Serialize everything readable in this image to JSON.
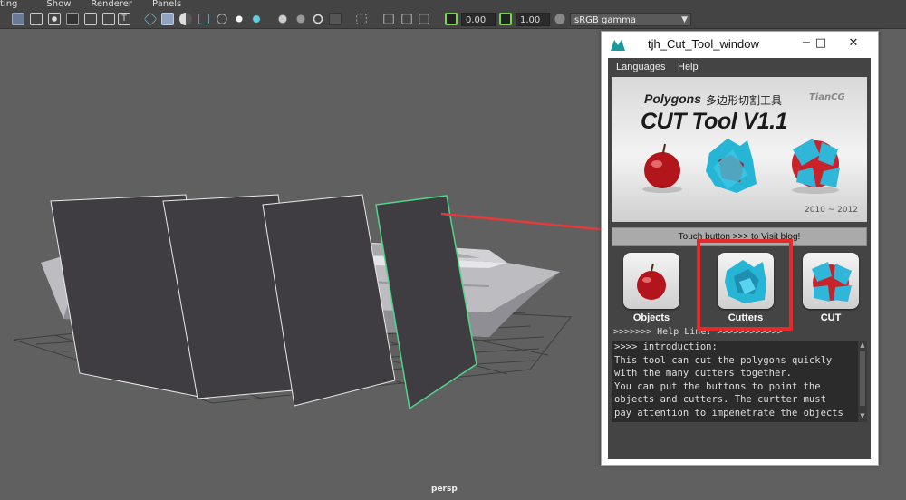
{
  "menubar": {
    "items": [
      "ting",
      "Show",
      "Renderer",
      "Panels"
    ]
  },
  "toolbar": {
    "exposure_value": "0.00",
    "gamma_value": "1.00",
    "colorspace_select": "sRGB gamma",
    "icons": [
      "grid-icon",
      "film-gate-icon",
      "resolution-gate-icon",
      "gate-mask-icon",
      "field-chart-icon",
      "safe-action-icon",
      "safe-title-icon",
      "wireframe-icon",
      "smooth-shade-icon",
      "use-default-material-icon",
      "wireframe-on-shaded-icon",
      "xray-icon",
      "lights-icon",
      "shadows-icon",
      "ambient-occlusion-icon",
      "motion-blur-icon",
      "anti-alias-icon",
      "depth-of-field-icon",
      "isolate-select-icon",
      "xray-joints-icon",
      "xray-active-components-icon",
      "backface-culling-icon",
      "exposure-icon",
      "gamma-icon",
      "color-management-icon"
    ]
  },
  "viewport": {
    "camera_label": "persp"
  },
  "tool_window": {
    "title": "tjh_Cut_Tool_window",
    "menu": [
      "Languages",
      "Help"
    ],
    "banner": {
      "line1": "Polygons",
      "line1_cn": "多边形切割工具",
      "line2": "CUT Tool V1.1",
      "logo": "TianCG",
      "years": "2010 ~ 2012"
    },
    "blog_button": "Touch button >>> to Visit blog!",
    "buttons": [
      {
        "label": "Objects",
        "icon": "apple-icon"
      },
      {
        "label": "Cutters",
        "icon": "cutters-icon"
      },
      {
        "label": "CUT",
        "icon": "cut-apple-icon"
      }
    ],
    "help_line": ">>>>>>> Help Line: >>>>>>>>>>>>",
    "help_text": ">>>> introduction:\nThis tool can cut the polygons quickly\nwith the many cutters together.\nYou can put the buttons to point the\nobjects and cutters. The curtter must\npay attention to impenetrate the objects\n."
  },
  "colors": {
    "highlight_box": "#e62a2a",
    "arrow": "#e33b3b",
    "selected_plane_outline": "#4fd68a",
    "viewport_bg": "#606060"
  }
}
